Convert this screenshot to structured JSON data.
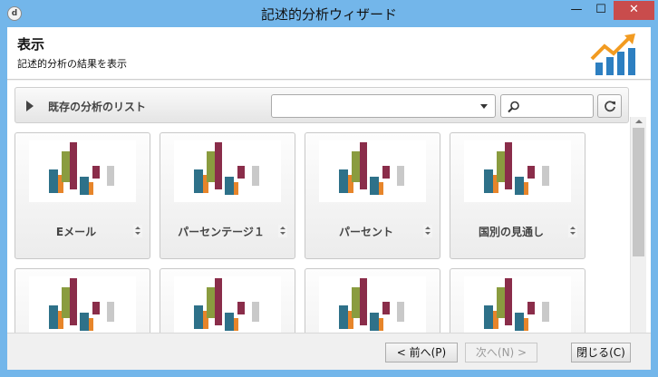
{
  "window": {
    "title": "記述的分析ウィザード",
    "app_icon": "d",
    "minimize": "—",
    "maximize": "☐",
    "close": "✕"
  },
  "header": {
    "title": "表示",
    "subtitle": "記述的分析の結果を表示",
    "logo_icon": "chart-growth-icon"
  },
  "list": {
    "label": "既存の分析のリスト",
    "dropdown_value": "",
    "search_value": ""
  },
  "cards": [
    {
      "label": "Eメール"
    },
    {
      "label": "パーセンテージ１"
    },
    {
      "label": "パーセント"
    },
    {
      "label": "国別の見通し"
    },
    {
      "label": ""
    },
    {
      "label": ""
    },
    {
      "label": ""
    },
    {
      "label": ""
    }
  ],
  "footer": {
    "prev": "< 前へ(P)",
    "next": "次へ(N) >",
    "close": "閉じる(C)"
  },
  "colors": {
    "window_frame": "#73b6ea",
    "close_button": "#c94c4c",
    "bar_teal": "#2e7189",
    "bar_orange": "#e7852a",
    "bar_olive": "#8a9c3f",
    "bar_maroon": "#8a2d4a",
    "logo_blue": "#2d7fc1",
    "logo_orange": "#f29b21"
  }
}
